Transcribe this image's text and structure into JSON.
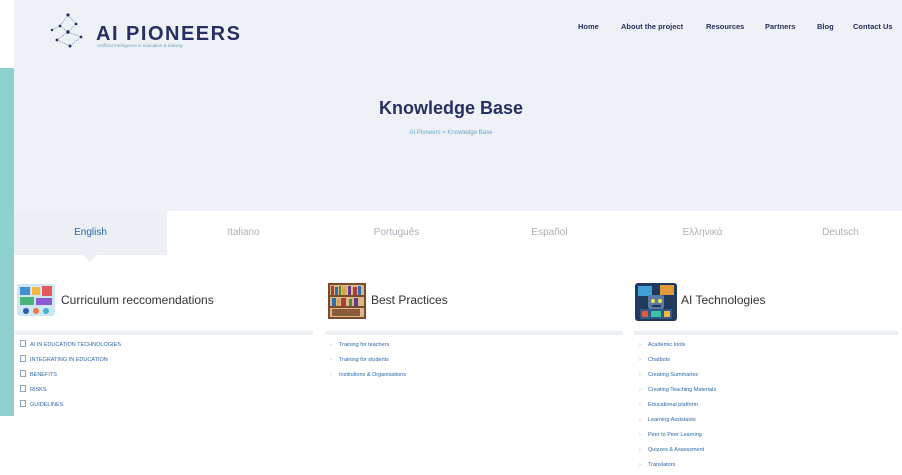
{
  "brand": {
    "title": "AI PIONEERS",
    "tagline": "Artificial Intelligence in education & training"
  },
  "nav": {
    "items": [
      {
        "label": "Home"
      },
      {
        "label": "About the project"
      },
      {
        "label": "Resources"
      },
      {
        "label": "Partners"
      },
      {
        "label": "Blog"
      },
      {
        "label": "Contact Us"
      }
    ]
  },
  "hero": {
    "title": "Knowledge Base",
    "breadcrumb": "AI Pioneers > Knowledge Base"
  },
  "tabs": [
    {
      "label": "English",
      "active": true
    },
    {
      "label": "Italiano"
    },
    {
      "label": "Português"
    },
    {
      "label": "Español"
    },
    {
      "label": "Ελληνικά"
    },
    {
      "label": "Deutsch"
    }
  ],
  "columns": [
    {
      "title": "Curriculum reccomendations",
      "icon": "curriculum-illustration-icon",
      "items": [
        "AI IN EDUCATION TECHNOLOGIES",
        "INTEGRATING IN EDUCATION",
        "BENEFITS",
        "RISKS",
        "GUIDELINES"
      ]
    },
    {
      "title": "Best Practices",
      "icon": "bookshelf-illustration-icon",
      "items": [
        "Training for teachers",
        "Training for students",
        "Institutions & Organisations"
      ]
    },
    {
      "title": "AI Technologies",
      "icon": "robot-workshop-illustration-icon",
      "items": [
        "Academic tools",
        "Chatbots",
        "Creating Summaries",
        "Creating Teaching Materials",
        "Educational platform",
        "Learning Assistants",
        "Peer to Peer Learning",
        "Quizzes & Assessment",
        "Translators"
      ]
    }
  ],
  "colors": {
    "brand_navy": "#2a2f63",
    "link_blue": "#2c66a8",
    "hero_bg": "#eef2f7",
    "teal_strip": "#8ecfd0"
  }
}
